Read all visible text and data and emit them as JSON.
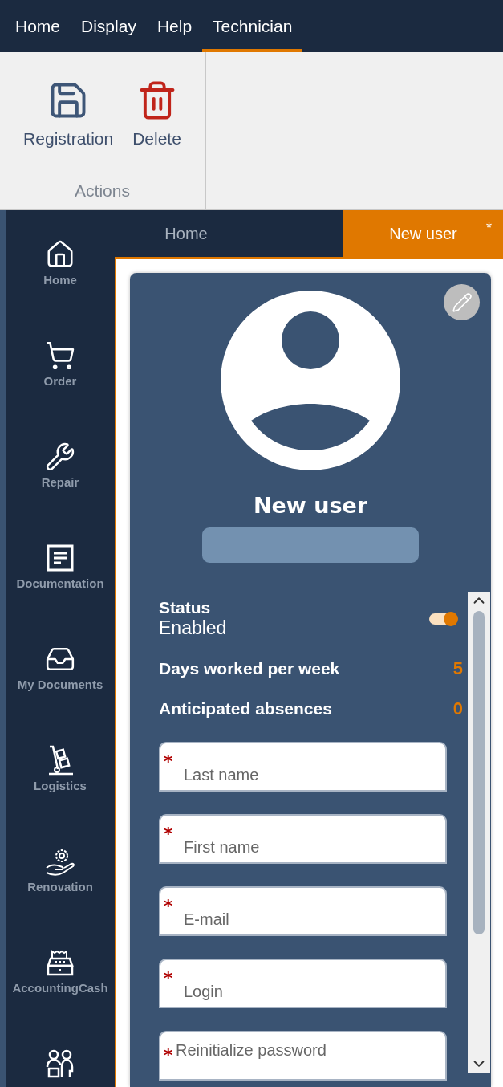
{
  "menu": [
    {
      "label": "Home",
      "selected": false
    },
    {
      "label": "Display",
      "selected": false
    },
    {
      "label": "Help",
      "selected": false
    },
    {
      "label": "Technician",
      "selected": true
    }
  ],
  "ribbon": {
    "buttons": [
      {
        "label": "Registration",
        "kind": "save"
      },
      {
        "label": "Delete",
        "kind": "delete"
      }
    ],
    "group_label": "Actions"
  },
  "sidebar": {
    "items": [
      {
        "label": "Home",
        "kind": "home"
      },
      {
        "label": "Order",
        "kind": "cart"
      },
      {
        "label": "Repair",
        "kind": "wrench"
      },
      {
        "label": "Documentation",
        "kind": "document"
      },
      {
        "label": "My Documents",
        "kind": "inbox"
      },
      {
        "label": "Logistics",
        "kind": "trolley"
      },
      {
        "label": "Renovation",
        "kind": "gear-hand"
      },
      {
        "label": "AccountingCash",
        "kind": "register"
      },
      {
        "kind": "people"
      }
    ]
  },
  "doc_tabs": [
    {
      "label": "Home",
      "selected": false
    },
    {
      "label": "New user",
      "selected": true,
      "mark": "*"
    }
  ],
  "card": {
    "title": "New user",
    "status": {
      "label": "Status",
      "value": "Enabled",
      "on": true
    },
    "stats": [
      {
        "label": "Days worked per week",
        "value": "5"
      },
      {
        "label": "Anticipated absences",
        "value": "0"
      }
    ],
    "fields": [
      {
        "placeholder": "Last name",
        "required": true,
        "kind": "text"
      },
      {
        "placeholder": "First name",
        "required": true,
        "kind": "text"
      },
      {
        "placeholder": "E-mail",
        "required": true,
        "kind": "text"
      },
      {
        "placeholder": "Login",
        "required": true,
        "kind": "text"
      },
      {
        "placeholder": "Reinitialize password",
        "required": true,
        "kind": "password"
      }
    ]
  }
}
